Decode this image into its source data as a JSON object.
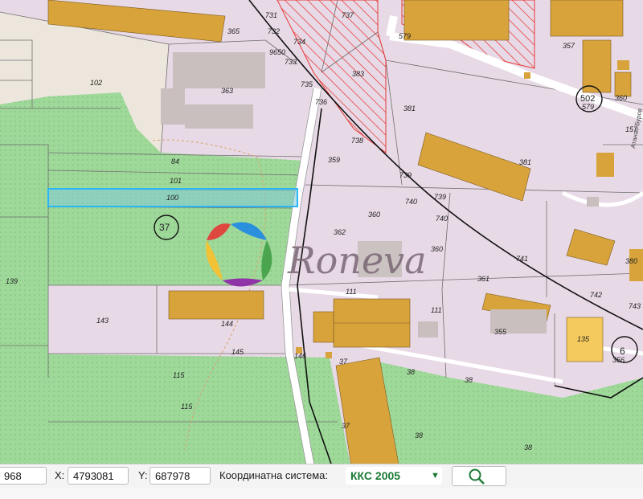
{
  "parcels": [
    "731",
    "737",
    "579",
    "357",
    "365",
    "732",
    "9650",
    "734",
    "733",
    "102",
    "363",
    "735",
    "383",
    "736",
    "502",
    "360",
    "381",
    "579",
    "157",
    "84",
    "738",
    "359",
    "381",
    "739",
    "101",
    "100",
    "740",
    "739",
    "360",
    "740",
    "37",
    "362",
    "741",
    "380",
    "139",
    "360",
    "361",
    "742",
    "111",
    "743",
    "111",
    "143",
    "144",
    "355",
    "135",
    "145",
    "146",
    "6",
    "356",
    "37",
    "115",
    "38",
    "38",
    "115",
    "37",
    "38",
    "38"
  ],
  "street_label": "Атанас Буров",
  "brand": {
    "name": "Roneva",
    "colors": [
      "#e53935",
      "#fbc02d",
      "#43a047",
      "#1e88e5",
      "#8e24aa"
    ]
  },
  "colors": {
    "parcel": "#e8d9e6",
    "green": "#9fd99a",
    "building": "#d8a33a",
    "building_light": "#f4c95d",
    "highlight": "#4fc3f7",
    "restricted": "#e53935"
  },
  "toolbar": {
    "left_value": "968",
    "x_label": "X:",
    "x_value": "4793081",
    "y_label": "Y:",
    "y_value": "687978",
    "system_label": "Координатна система:",
    "system_value": "ККС 2005",
    "dropdown_icon": "triangle-down-icon",
    "search_icon": "magnifier-icon"
  }
}
